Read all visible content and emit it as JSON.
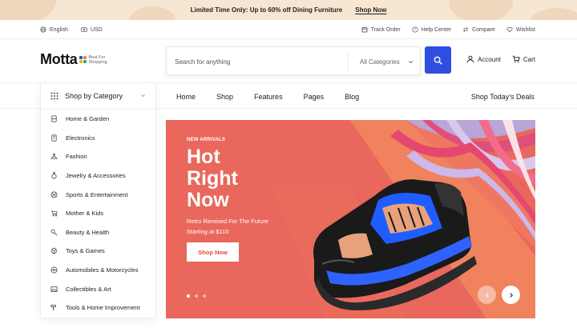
{
  "promo": {
    "text": "Limited Time Only: Up to 60% off Dining Furniture",
    "link": "Shop Now"
  },
  "utility": {
    "language": "English",
    "currency": "USD",
    "track_order": "Track Order",
    "help_center": "Help Center",
    "compare": "Compare",
    "wishlist": "Wishlist"
  },
  "header": {
    "logo_word": "Motta",
    "logo_tag_line1": "Best For",
    "logo_tag_line2": "Shopping",
    "search_placeholder": "Search for anything",
    "category_select": "All Categories",
    "account": "Account",
    "cart": "Cart"
  },
  "nav": {
    "items": [
      "Home",
      "Shop",
      "Features",
      "Pages",
      "Blog"
    ],
    "deals": "Shop Today's Deals"
  },
  "categories": {
    "title": "Shop by Category",
    "items": [
      {
        "label": "Home & Garden",
        "icon": "home-garden-icon"
      },
      {
        "label": "Electronics",
        "icon": "electronics-icon"
      },
      {
        "label": "Fashion",
        "icon": "fashion-icon"
      },
      {
        "label": "Jewelry & Accessories",
        "icon": "jewelry-icon"
      },
      {
        "label": "Sports & Entertainment",
        "icon": "sports-icon"
      },
      {
        "label": "Mother & Kids",
        "icon": "stroller-icon"
      },
      {
        "label": "Beauty & Health",
        "icon": "beauty-icon"
      },
      {
        "label": "Toys & Games",
        "icon": "toys-icon"
      },
      {
        "label": "Automobiles & Motorcycles",
        "icon": "auto-icon"
      },
      {
        "label": "Collectibles & Art",
        "icon": "art-icon"
      },
      {
        "label": "Tools & Home Improvement",
        "icon": "tools-icon"
      }
    ]
  },
  "hero": {
    "kicker": "NEW ARRIVALS",
    "title_line1": "Hot",
    "title_line2": "Right",
    "title_line3": "Now",
    "sub_line1": "Retro Remixed For The Future",
    "sub_line2": "Starting at $110",
    "button": "Shop Now",
    "slide_count": 3,
    "active_slide": 1
  },
  "colors": {
    "accent": "#2f4ee0",
    "hero_bg": "#e9675c",
    "promo_bg": "#f6e6d2",
    "logo_dots": [
      "#2f4ee0",
      "#ff7a3d",
      "#f2b705",
      "#22b07d"
    ]
  }
}
